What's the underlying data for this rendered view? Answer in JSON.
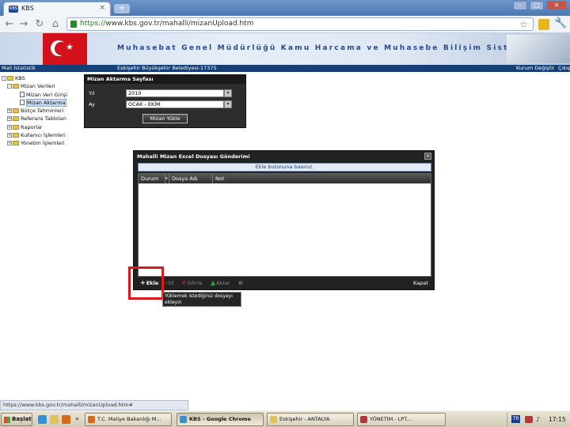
{
  "browser": {
    "tab_title": "KBS",
    "tab_favicon_text": "KBS",
    "tab_close": "×",
    "new_tab": "+",
    "url_scheme": "https://",
    "url_rest": "www.kbs.gov.tr/mahalli/mizanUpload.htm",
    "window_controls": [
      "–",
      "□",
      "✕"
    ],
    "icons": [
      "back-icon",
      "forward-icon",
      "reload-icon",
      "home-icon",
      "lock-icon",
      "star-icon",
      "extension-icon",
      "wrench-icon"
    ]
  },
  "site": {
    "banner_title": "Muhasebat Genel Müdürlüğü Kamu Harcama ve Muhasebe Bilişim Sistemi",
    "info_left": "Mali İstatistik",
    "info_center": "Eskişehir Büyükşehir Belediyesi-17375",
    "info_right_user": "Kurum Değiştir",
    "info_right_exit": "Çıkış"
  },
  "tree": [
    {
      "label": "KBS",
      "type": "root",
      "expander": "–",
      "indent": 0,
      "selected": false
    },
    {
      "label": "Mizan Verileri",
      "type": "folder",
      "expander": "–",
      "indent": 1,
      "selected": false
    },
    {
      "label": "Mizan Veri Girişi",
      "type": "doc",
      "expander": "",
      "indent": 2,
      "selected": false
    },
    {
      "label": "Mizan Aktarma",
      "type": "doc",
      "expander": "",
      "indent": 2,
      "selected": true
    },
    {
      "label": "Bütçe Tahminleri",
      "type": "folder",
      "expander": "+",
      "indent": 1,
      "selected": false
    },
    {
      "label": "Referans Tabloları",
      "type": "folder",
      "expander": "+",
      "indent": 1,
      "selected": false
    },
    {
      "label": "Raporlar",
      "type": "folder",
      "expander": "+",
      "indent": 1,
      "selected": false
    },
    {
      "label": "Kullanıcı İşlemleri",
      "type": "folder",
      "expander": "+",
      "indent": 1,
      "selected": false
    },
    {
      "label": "Yönetim İşlemleri",
      "type": "folder",
      "expander": "+",
      "indent": 1,
      "selected": false
    }
  ],
  "mizan_panel": {
    "title": "Mizan Aktarma Sayfası",
    "year_label": "Yıl",
    "year_value": "2010",
    "month_label": "Ay",
    "month_value": "OCAK - EKİM",
    "button_label": "Mizan Yükle"
  },
  "upload_dialog": {
    "title": "Mahalli Mizan Excel Dosyası Gönderimi",
    "info": "Ekle butonuna basınız.",
    "columns": [
      "Durum",
      "Dosya Adı",
      "Not"
    ],
    "toolbar": {
      "add": "Ekle",
      "delete": "Sil",
      "clear": "Sıfırla",
      "transfer": "Aktar",
      "close": "Kapat"
    },
    "tooltip": "Yüklemek istediğiniz dosyayı ekleyin"
  },
  "statusbar": "https://www.kbs.gov.tr/mahalli/mizanUpload.htm#",
  "taskbar": {
    "start": "Başlat",
    "chevron": "»",
    "tasks": [
      {
        "label": "T.C. Maliye Bakanlığı M...",
        "active": false,
        "icon_color": "#d96a1c"
      },
      {
        "label": "KBS - Google Chrome",
        "active": true,
        "icon_color": "#3a8fd3"
      },
      {
        "label": "Eskişehir - ANTALYA",
        "active": false,
        "icon_color": "#e2c25b"
      },
      {
        "label": "YÖNETİM - LPT...",
        "active": false,
        "icon_color": "#b33a3a"
      }
    ],
    "tray_lang": "TR",
    "clock": "17:15"
  }
}
